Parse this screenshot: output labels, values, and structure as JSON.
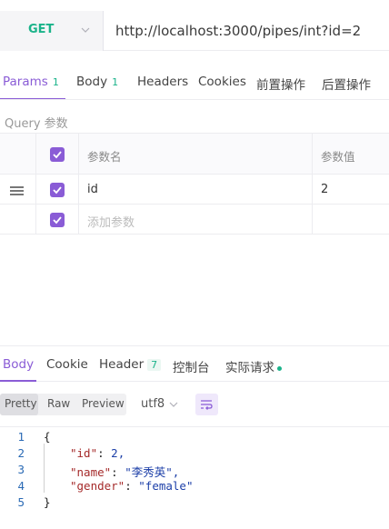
{
  "request": {
    "method": "GET",
    "url": "http://localhost:3000/pipes/int?id=2"
  },
  "request_tabs": [
    {
      "label": "Params",
      "count": "1",
      "active": true
    },
    {
      "label": "Body",
      "count": "1"
    },
    {
      "label": "Headers"
    },
    {
      "label": "Cookies"
    },
    {
      "label": "前置操作"
    },
    {
      "label": "后置操作"
    }
  ],
  "query": {
    "section_label": "Query 参数",
    "columns": {
      "name": "参数名",
      "value": "参数值"
    },
    "rows": [
      {
        "name": "id",
        "value": "2",
        "checked": true
      }
    ],
    "add_placeholder": "添加参数"
  },
  "response": {
    "tabs": [
      {
        "label": "Body",
        "active": true
      },
      {
        "label": "Cookie"
      },
      {
        "label": "Header",
        "badge": "7"
      },
      {
        "label": "控制台"
      },
      {
        "label": "实际请求"
      }
    ],
    "formats": [
      "Pretty",
      "Raw",
      "Preview"
    ],
    "active_format": "Pretty",
    "encoding": "utf8",
    "body_lines": [
      {
        "ln": "1",
        "text": "{"
      },
      {
        "ln": "2",
        "key": "\"id\"",
        "value": "2,"
      },
      {
        "ln": "3",
        "key": "\"name\"",
        "value": "\"李秀英\","
      },
      {
        "ln": "4",
        "key": "\"gender\"",
        "value": "\"female\""
      },
      {
        "ln": "5",
        "text": "}"
      }
    ]
  },
  "colors": {
    "accent": "#8a5cd6",
    "method_green": "#1ab38a"
  },
  "icons": [
    "chevron-down-icon",
    "checkbox-checked-icon",
    "drag-handle-icon",
    "wrap-lines-icon"
  ]
}
